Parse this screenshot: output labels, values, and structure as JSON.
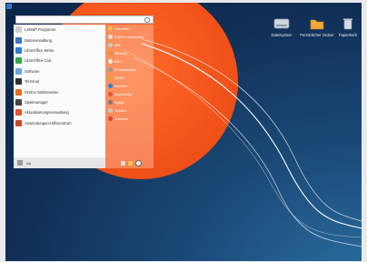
{
  "desktop": {
    "icons": [
      {
        "label": "Dateisystem",
        "icon": "drive-icon"
      },
      {
        "label": "Persönlicher Ordner",
        "icon": "folder-icon"
      },
      {
        "label": "Papierkorb",
        "icon": "trash-icon"
      }
    ]
  },
  "menu": {
    "search_placeholder": "",
    "favorites": [
      {
        "label": "LXMaP Programm",
        "color": "#cfcfcf"
      },
      {
        "label": "Dateiverwaltung",
        "color": "#3a73c4"
      },
      {
        "label": "LibreOffice Writer",
        "color": "#2f7bd9"
      },
      {
        "label": "LibreOffice Calc",
        "color": "#2fa84f"
      },
      {
        "label": "Software",
        "color": "#6aa6dd"
      },
      {
        "label": "Terminal",
        "color": "#2f2f2f"
      },
      {
        "label": "Firefox Webbrowser",
        "color": "#e66a1f"
      },
      {
        "label": "Spielmanager",
        "color": "#444444"
      },
      {
        "label": "Aktualisierungsverwaltung",
        "color": "#e0552a"
      },
      {
        "label": "Anwendungen-Hilfszentrum",
        "color": "#c84a2a"
      }
    ],
    "categories": [
      {
        "label": "Favoriten",
        "color": "#f0c24a"
      },
      {
        "label": "Zuletzt verwendet",
        "color": "#dedede"
      },
      {
        "label": "Alle",
        "color": "#c9c9c9"
      },
      {
        "label": "Bildung",
        "color": "#f08a3a"
      },
      {
        "label": "Büro",
        "color": "#e8e8e8"
      },
      {
        "label": "Einstellungen",
        "color": "#9a9a9a"
      },
      {
        "label": "Grafik",
        "color": "#d9a23a"
      },
      {
        "label": "Internet",
        "color": "#2f7bd9"
      },
      {
        "label": "Multimedia",
        "color": "#e05a3a"
      },
      {
        "label": "Spiele",
        "color": "#7a7a7a"
      },
      {
        "label": "System",
        "color": "#c8c8c8"
      },
      {
        "label": "Zubehör",
        "color": "#d8483a"
      }
    ],
    "user_name": "ich"
  },
  "colors": {
    "sun": "#f2531a",
    "background": "#102e55",
    "menu_bg": "#fbfbfb"
  }
}
